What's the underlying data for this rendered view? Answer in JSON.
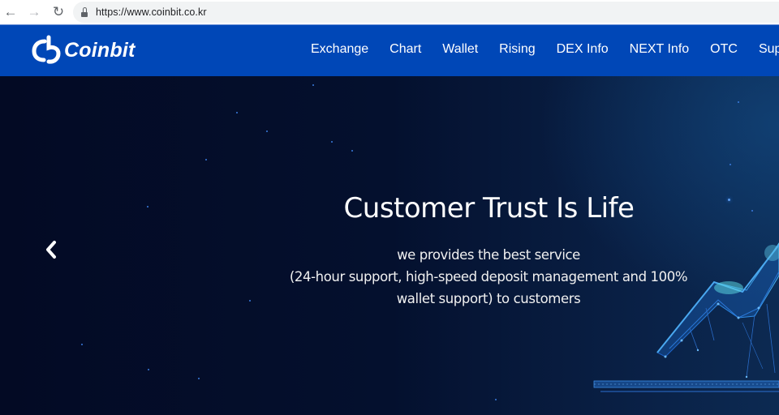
{
  "browser": {
    "url": "https://www.coinbit.co.kr",
    "icons": {
      "back": "arrow-left-icon",
      "forward": "arrow-right-icon",
      "reload": "reload-icon",
      "secure": "lock-icon"
    }
  },
  "header": {
    "brand": "Coinbit",
    "logo_icon": "coinbit-logo-icon",
    "nav": [
      {
        "label": "Exchange"
      },
      {
        "label": "Chart"
      },
      {
        "label": "Wallet"
      },
      {
        "label": "Rising"
      },
      {
        "label": "DEX Info"
      },
      {
        "label": "NEXT Info"
      },
      {
        "label": "OTC"
      },
      {
        "label": "Suppo"
      }
    ],
    "colors": {
      "background": "#0047b7",
      "text": "#ffffff"
    }
  },
  "hero": {
    "title": "Customer Trust Is Life",
    "subtitle_lines": [
      "we provides the best service",
      "(24-hour support, high-speed deposit management and 100%",
      "wallet support) to customers"
    ],
    "prev_icon": "chevron-left-icon",
    "illustration": "network-mesh-chart-illustration",
    "colors": {
      "background": "#030b25",
      "accent": "#2f7fe8"
    }
  }
}
